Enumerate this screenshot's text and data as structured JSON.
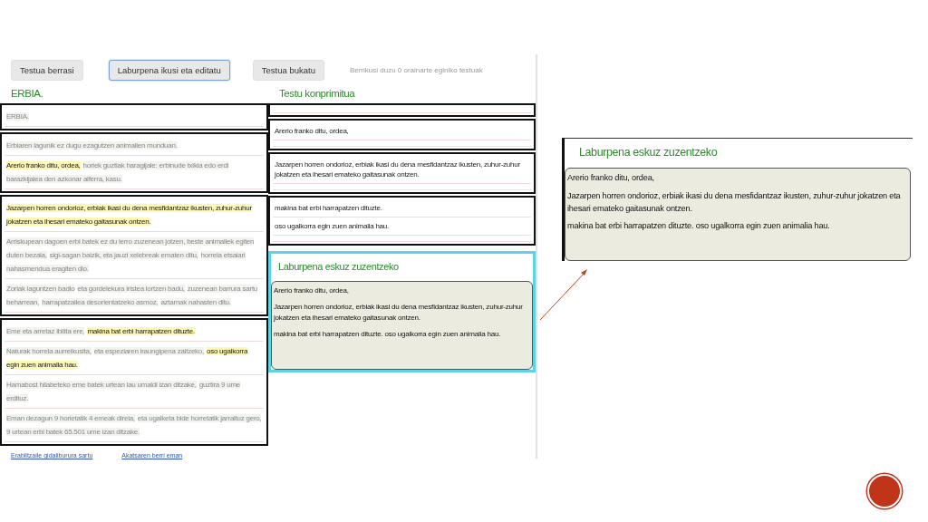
{
  "toolbar": {
    "buttons": [
      {
        "label": "Testua berrasi",
        "selected": false
      },
      {
        "label": "Laburpena ikusi eta editatu",
        "selected": true
      },
      {
        "label": "Testua bukatu",
        "selected": false
      }
    ],
    "status": "Berrikusi duzu 0 orainarte eginiko testuak"
  },
  "original": {
    "title": "ERBIA.",
    "paragraphs": [
      {
        "sentences": [
          [
            {
              "text": "ERBIA.",
              "highlighted": false
            }
          ]
        ]
      },
      {
        "sentences": [
          [
            {
              "text": "Erbiaren lagunik ez dugu ezagutzen animalien munduan.",
              "highlighted": false
            }
          ],
          [
            {
              "text": "Arerio franko ditu, ordea,",
              "highlighted": true
            },
            {
              "text": "horiek guztiak haragijale: erbinude txikia edo erdi barazkijalea den azkonar alferra, kasu.",
              "highlighted": false
            }
          ]
        ]
      },
      {
        "sentences": [
          [
            {
              "text": "Jazarpen horren ondorioz, erbiak ikasi du dena mesfidantzaz ikusten, zuhur-zuhur jokatzen eta ihesari emateko gaitasunak ontzen.",
              "highlighted": true
            }
          ],
          [
            {
              "text": "Arriskupean dagoen erbi batek ez du lerro zuzenean jotzen, beste animaliek egiten duten bezala,",
              "highlighted": false
            },
            {
              "text": "sigi-sagan baizik, eta jauzi xelebreak ematen ditu,",
              "highlighted": false
            },
            {
              "text": "horrela etsaiari nahasmendua eragiten dio.",
              "highlighted": false
            }
          ],
          [
            {
              "text": "Zoriak laguntzen badio",
              "highlighted": false
            },
            {
              "text": "eta gordelekura iristea lortzen badu,",
              "highlighted": false
            },
            {
              "text": "zuzenean barrura sartu beharrean,",
              "highlighted": false
            },
            {
              "text": "harrapatzailea desorientatzeko asmoz,",
              "highlighted": false
            },
            {
              "text": "aztarnak nahasten ditu.",
              "highlighted": false
            }
          ]
        ]
      },
      {
        "sentences": [
          [
            {
              "text": "Eme eta arretaz ibilita ere,",
              "highlighted": false
            },
            {
              "text": "makina bat erbi harrapatzen dituzte.",
              "highlighted": true
            }
          ],
          [
            {
              "text": "Naturak horrela aurreikusita,",
              "highlighted": false
            },
            {
              "text": "eta espeziaren iraungipena zaitzeko,",
              "highlighted": false
            },
            {
              "text": "oso ugalkorra egin zuen animalia hau.",
              "highlighted": true
            }
          ],
          [
            {
              "text": "Hamabost hilabeteko eme batek urtean lau umaldi izan ditzake,",
              "highlighted": false
            },
            {
              "text": "guztira 9 ume erdituz.",
              "highlighted": false
            }
          ],
          [
            {
              "text": "Eman dezagun 9 horietatik 4 emeak direla,",
              "highlighted": false
            },
            {
              "text": "eta ugalketa bide horretatik jarraituz gero, 9 urtean erbi batek 65.501 ume izan ditzake.",
              "highlighted": false
            }
          ]
        ]
      }
    ]
  },
  "compressed": {
    "title": "Testu konprimitua",
    "paragraphs": [
      {
        "kind": "empty"
      },
      {
        "kind": "text",
        "sentences": [
          "Arerio franko ditu, ordea,"
        ]
      },
      {
        "kind": "text",
        "sentences": [
          "Jazarpen horren ondorioz, erbiak ikasi du dena mesfidantzaz ikusten, zuhur-zuhur jokatzen eta ihesari emateko gaitasunak ontzen."
        ]
      },
      {
        "kind": "text",
        "sentences": [
          "makina bat erbi harrapatzen dituzte.",
          "oso ugalkorra egin zuen animalia hau."
        ]
      }
    ]
  },
  "editor": {
    "title": "Laburpena eskuz zuzentzeko",
    "lines": [
      "Arerio franko ditu, ordea,",
      "Jazarpen horren ondorioz, erbiak ikasi du dena mesfidantzaz ikusten, zuhur-zuhur jokatzen eta ihesari emateko gaitasunak ontzen.",
      "makina bat erbi harrapatzen dituzte. oso ugalkorra egin zuen animalia hau."
    ]
  },
  "links": [
    "Erabiltzaile gidaliburura sartu",
    "Akatsaren berri eman"
  ],
  "callout": {
    "title": "Laburpena eskuz zuzentzeko",
    "lines": [
      "Arerio franko ditu, ordea,",
      "Jazarpen horren ondorioz, erbiak ikasi du dena mesfidantzaz ikusten, zuhur-zuhur jokatzen eta ihesari emateko gaitasunak ontzen.",
      "makina bat erbi harrapatzen dituzte. oso ugalkorra egin zuen animalia hau."
    ]
  }
}
